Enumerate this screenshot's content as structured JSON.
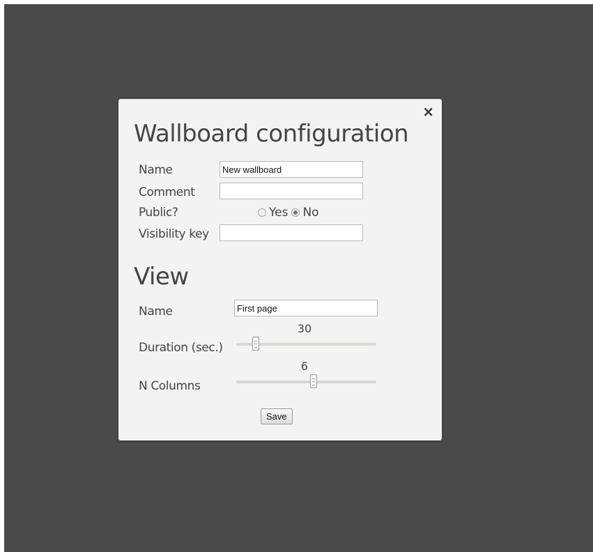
{
  "dialog": {
    "close_icon": "×",
    "title": "Wallboard configuration",
    "fields": {
      "name_label": "Name",
      "name_value": "New wallboard",
      "comment_label": "Comment",
      "comment_value": "",
      "public_label": "Public?",
      "public_options": [
        "Yes",
        "No"
      ],
      "public_selected": "No",
      "visibility_label": "Visibility key",
      "visibility_value": ""
    },
    "view": {
      "title": "View",
      "name_label": "Name",
      "name_value": "First page",
      "duration_label": "Duration (sec.)",
      "duration_value": "30",
      "duration_fraction": 0.14,
      "columns_label": "N Columns",
      "columns_value": "6",
      "columns_fraction": 0.55
    },
    "save_label": "Save"
  }
}
